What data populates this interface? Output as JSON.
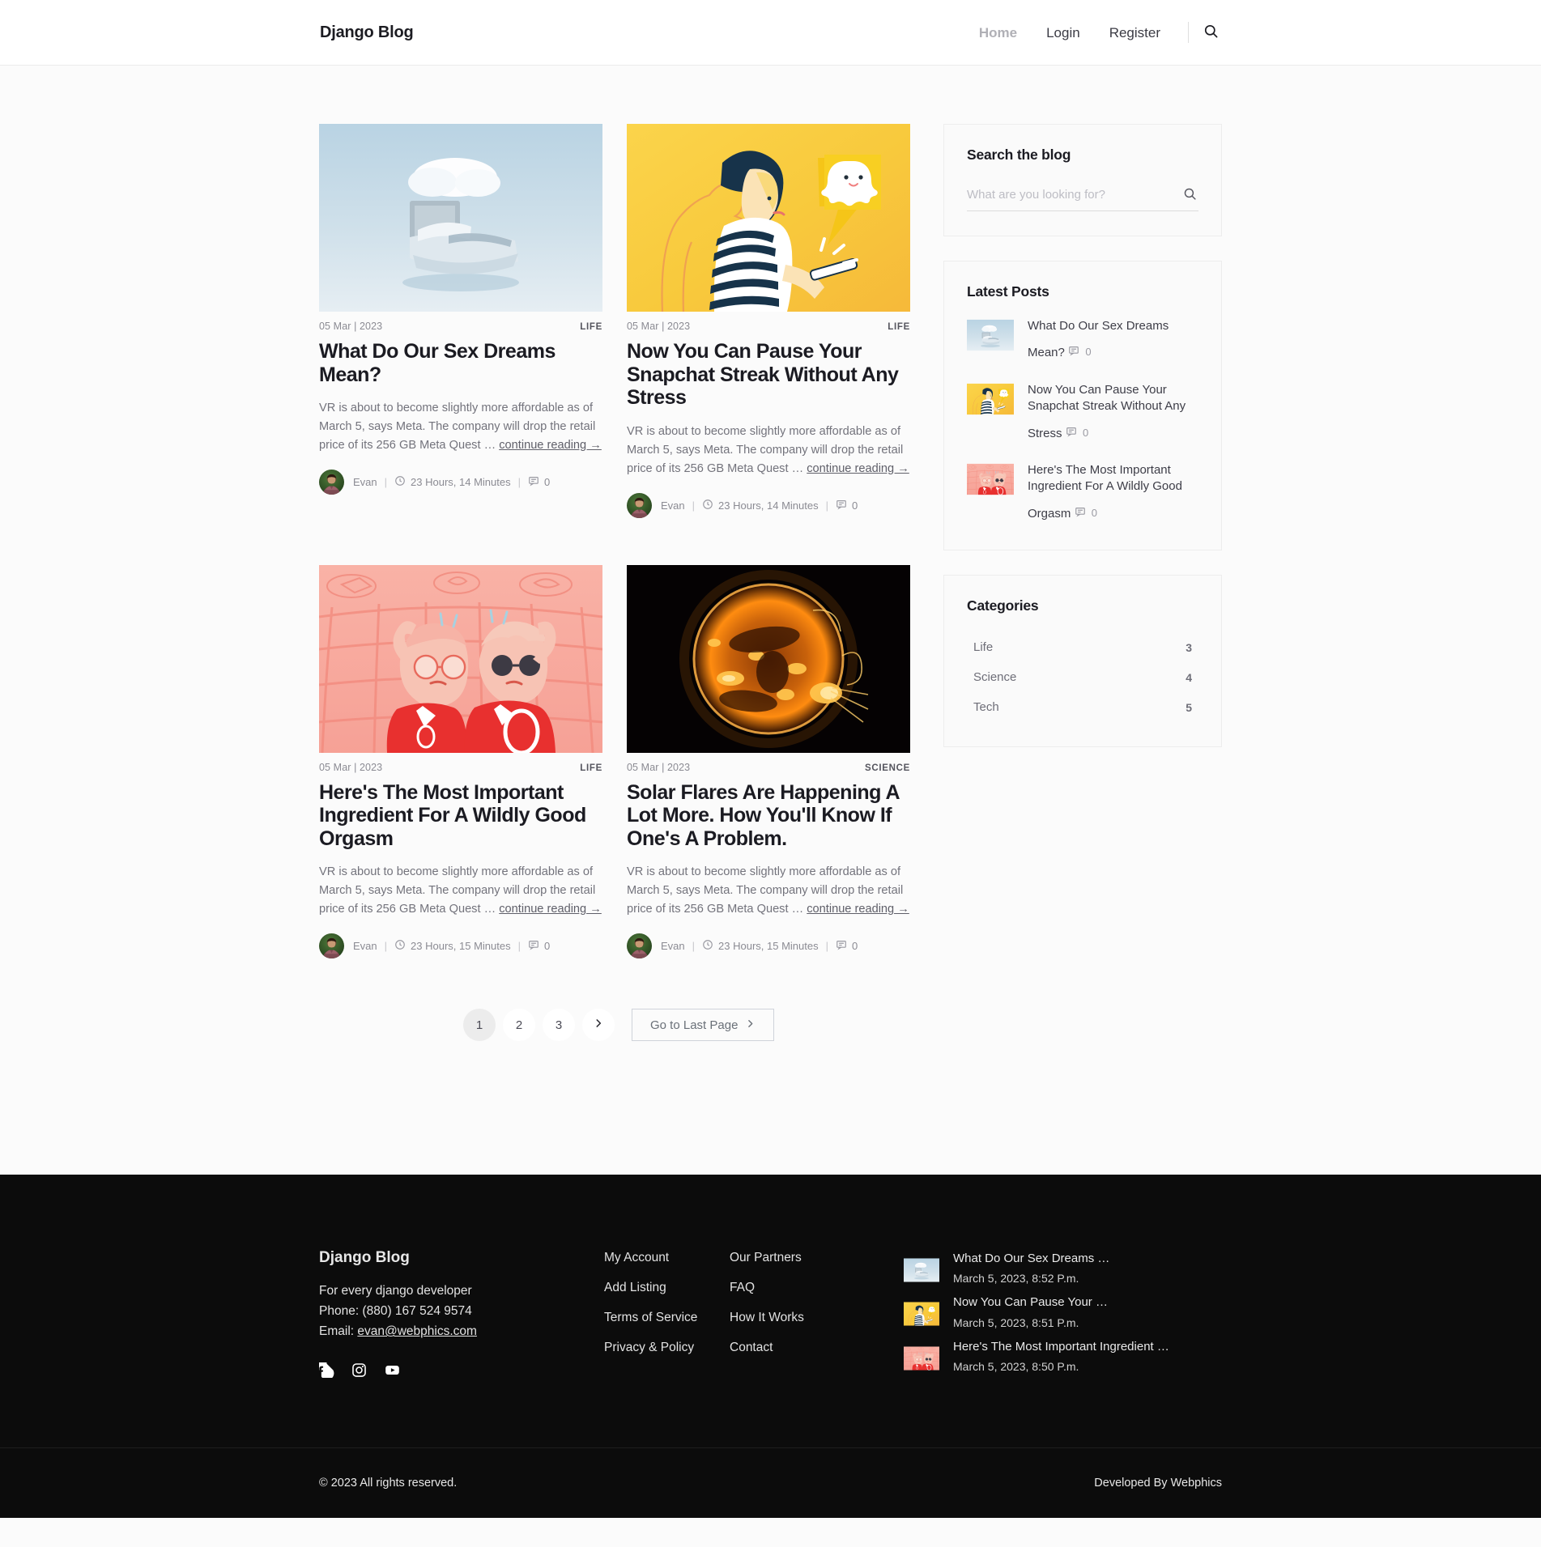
{
  "header": {
    "brand": "Django Blog",
    "nav": [
      {
        "label": "Home",
        "active": true
      },
      {
        "label": "Login",
        "active": false
      },
      {
        "label": "Register",
        "active": false
      }
    ],
    "search_icon": "search-icon"
  },
  "posts": [
    {
      "date": "05 Mar | 2023",
      "category": "LIFE",
      "title": "What Do Our Sex Dreams Mean?",
      "excerpt": "VR is about to become slightly more affordable as of March 5, says Meta. The company will drop the retail price of its 256 GB Meta Quest … ",
      "continue_label": "continue reading →",
      "author": "Evan",
      "read_time": "23 Hours, 14 Minutes",
      "comments": "0",
      "image": "floating-bed-cloud"
    },
    {
      "date": "05 Mar | 2023",
      "category": "LIFE",
      "title": "Now You Can Pause Your Snapchat Streak Without Any Stress",
      "excerpt": "VR is about to become slightly more affordable as of March 5, says Meta. The company will drop the retail price of its 256 GB Meta Quest … ",
      "continue_label": "continue reading →",
      "author": "Evan",
      "read_time": "23 Hours, 14 Minutes",
      "comments": "0",
      "image": "snapchat-illustration"
    },
    {
      "date": "05 Mar | 2023",
      "category": "LIFE",
      "title": "Here's The Most Important Ingredient For A Wildly Good Orgasm",
      "excerpt": "VR is about to become slightly more affordable as of March 5, says Meta. The company will drop the retail price of its 256 GB Meta Quest … ",
      "continue_label": "continue reading →",
      "author": "Evan",
      "read_time": "23 Hours, 15 Minutes",
      "comments": "0",
      "image": "pink-couple-illustration"
    },
    {
      "date": "05 Mar | 2023",
      "category": "SCIENCE",
      "title": "Solar Flares Are Happening A Lot More. How You'll Know If One's A Problem.",
      "excerpt": "VR is about to become slightly more affordable as of March 5, says Meta. The company will drop the retail price of its 256 GB Meta Quest … ",
      "continue_label": "continue reading →",
      "author": "Evan",
      "read_time": "23 Hours, 15 Minutes",
      "comments": "0",
      "image": "solar-flare"
    }
  ],
  "pagination": {
    "pages": [
      "1",
      "2",
      "3"
    ],
    "current": "1",
    "next_icon": "chevron-right-icon",
    "last_page_label": "Go to Last Page"
  },
  "sidebar": {
    "search_widget": {
      "title": "Search the blog",
      "placeholder": "What are you looking for?",
      "value": ""
    },
    "latest_posts": {
      "title": "Latest Posts",
      "items": [
        {
          "title": "What Do Our Sex Dreams Mean?",
          "comments": "0",
          "image": "floating-bed-cloud"
        },
        {
          "title": "Now You Can Pause Your Snapchat Streak Without Any Stress",
          "comments": "0",
          "image": "snapchat-illustration"
        },
        {
          "title": "Here's The Most Important Ingredient For A Wildly Good Orgasm",
          "comments": "0",
          "image": "pink-couple-illustration"
        }
      ]
    },
    "categories": {
      "title": "Categories",
      "items": [
        {
          "label": "Life",
          "count": "3"
        },
        {
          "label": "Science",
          "count": "4"
        },
        {
          "label": "Tech",
          "count": "5"
        }
      ]
    }
  },
  "footer": {
    "brand": "Django Blog",
    "tagline": "For every django developer",
    "phone": "Phone: (880) 167 524 9574",
    "email_prefix": "Email: ",
    "email": "evan@webphics.com",
    "socials": [
      "facebook-icon",
      "instagram-icon",
      "youtube-icon"
    ],
    "links_col1": [
      "My Account",
      "Add Listing",
      "Terms of Service",
      "Privacy & Policy"
    ],
    "links_col2": [
      "Our Partners",
      "FAQ",
      "How It Works",
      "Contact"
    ],
    "recent_posts": [
      {
        "title": "What Do Our Sex Dreams …",
        "date": "March 5, 2023, 8:52 P.m.",
        "image": "floating-bed-cloud"
      },
      {
        "title": "Now You Can Pause Your …",
        "date": "March 5, 2023, 8:51 P.m.",
        "image": "snapchat-illustration"
      },
      {
        "title": "Here's The Most Important Ingredient …",
        "date": "March 5, 2023, 8:50 P.m.",
        "image": "pink-couple-illustration"
      }
    ],
    "copyright": "© 2023 All rights reserved.",
    "developed_by": "Developed By Webphics"
  }
}
